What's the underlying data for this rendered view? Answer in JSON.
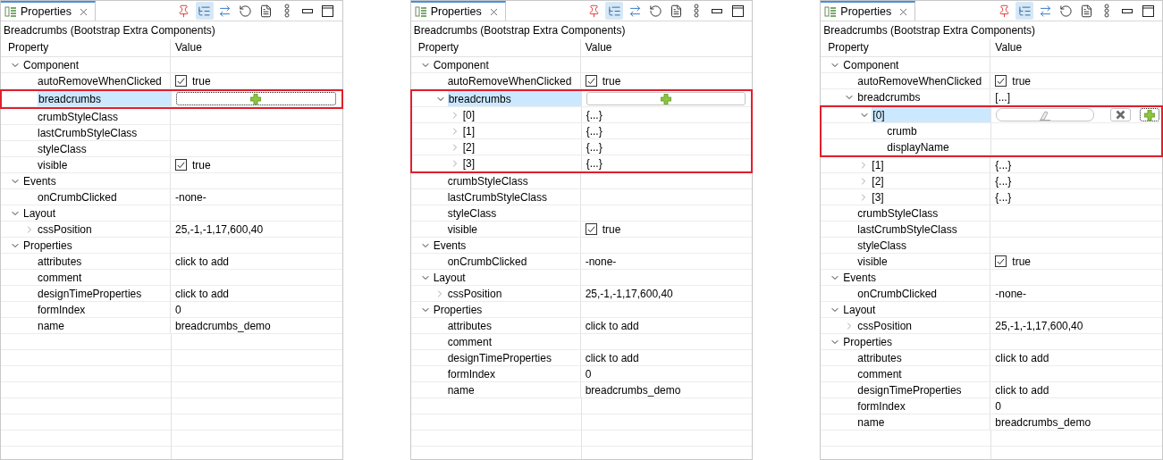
{
  "panels": [
    {
      "tab": {
        "title": "Properties",
        "selected": true
      },
      "subtitle": "Breadcrumbs (Bootstrap Extra Components)",
      "columns": [
        "Property",
        "Value"
      ],
      "rows": [
        {
          "label": "Component",
          "expanded": true,
          "children": [
            {
              "label": "autoRemoveWhenClicked",
              "checked": true,
              "value": "true",
              "selected": false
            },
            {
              "label": "breadcrumbs",
              "selected": true,
              "highlighted": true,
              "editor": {
                "kind": "add",
                "focused": true
              }
            },
            {
              "label": "crumbStyleClass",
              "selected": false
            },
            {
              "label": "lastCrumbStyleClass",
              "selected": false
            },
            {
              "label": "styleClass",
              "selected": false
            },
            {
              "label": "visible",
              "checked": true,
              "value": "true",
              "selected": false
            }
          ]
        },
        {
          "label": "Events",
          "expanded": true,
          "children": [
            {
              "label": "onCrumbClicked",
              "value": "-none-",
              "selected": false
            }
          ]
        },
        {
          "label": "Layout",
          "expanded": true,
          "children": [
            {
              "label": "cssPosition",
              "value": "25,-1,-1,17,600,40",
              "expanded": false,
              "selected": false
            }
          ]
        },
        {
          "label": "Properties",
          "expanded": true,
          "children": [
            {
              "label": "attributes",
              "value": "click to add",
              "selected": false
            },
            {
              "label": "comment",
              "selected": false
            },
            {
              "label": "designTimeProperties",
              "value": "click to add",
              "selected": false
            },
            {
              "label": "formIndex",
              "value": "0",
              "selected": false
            },
            {
              "label": "name",
              "value": "breadcrumbs_demo",
              "selected": false
            }
          ]
        }
      ]
    },
    {
      "tab": {
        "title": "Properties",
        "selected": true
      },
      "subtitle": "Breadcrumbs (Bootstrap Extra Components)",
      "columns": [
        "Property",
        "Value"
      ],
      "rows": [
        {
          "label": "Component",
          "expanded": true,
          "children": [
            {
              "label": "autoRemoveWhenClicked",
              "checked": true,
              "value": "true",
              "selected": false
            },
            {
              "label": "breadcrumbs",
              "selected": true,
              "highlighted": true,
              "expanded": true,
              "editor": {
                "kind": "add",
                "focused": false
              },
              "children": [
                {
                  "label": "[0]",
                  "value": "{...}",
                  "expanded": false,
                  "selected": false,
                  "highlighted": true
                },
                {
                  "label": "[1]",
                  "value": "{...}",
                  "expanded": false,
                  "selected": false,
                  "highlighted": true
                },
                {
                  "label": "[2]",
                  "value": "{...}",
                  "expanded": false,
                  "selected": false,
                  "highlighted": true
                },
                {
                  "label": "[3]",
                  "value": "{...}",
                  "expanded": false,
                  "selected": false,
                  "highlighted": true
                }
              ]
            },
            {
              "label": "crumbStyleClass",
              "selected": false
            },
            {
              "label": "lastCrumbStyleClass",
              "selected": false
            },
            {
              "label": "styleClass",
              "selected": false
            },
            {
              "label": "visible",
              "checked": true,
              "value": "true",
              "selected": false
            }
          ]
        },
        {
          "label": "Events",
          "expanded": true,
          "children": [
            {
              "label": "onCrumbClicked",
              "value": "-none-",
              "selected": false
            }
          ]
        },
        {
          "label": "Layout",
          "expanded": true,
          "children": [
            {
              "label": "cssPosition",
              "value": "25,-1,-1,17,600,40",
              "expanded": false,
              "selected": false
            }
          ]
        },
        {
          "label": "Properties",
          "expanded": true,
          "children": [
            {
              "label": "attributes",
              "value": "click to add",
              "selected": false
            },
            {
              "label": "comment",
              "selected": false
            },
            {
              "label": "designTimeProperties",
              "value": "click to add",
              "selected": false
            },
            {
              "label": "formIndex",
              "value": "0",
              "selected": false
            },
            {
              "label": "name",
              "value": "breadcrumbs_demo",
              "selected": false
            }
          ]
        }
      ]
    },
    {
      "tab": {
        "title": "Properties",
        "selected": true
      },
      "subtitle": "Breadcrumbs (Bootstrap Extra Components)",
      "columns": [
        "Property",
        "Value"
      ],
      "rows": [
        {
          "label": "Component",
          "expanded": true,
          "children": [
            {
              "label": "autoRemoveWhenClicked",
              "checked": true,
              "value": "true",
              "selected": false
            },
            {
              "label": "breadcrumbs",
              "value": "[...]",
              "selected": false,
              "expanded": true,
              "children": [
                {
                  "label": "[0]",
                  "expanded": true,
                  "selected": true,
                  "highlighted": true,
                  "editor": {
                    "kind": "edit",
                    "focused": true
                  },
                  "children": [
                    {
                      "label": "crumb",
                      "selected": false,
                      "highlighted": true
                    },
                    {
                      "label": "displayName",
                      "selected": false,
                      "highlighted": true
                    }
                  ]
                },
                {
                  "label": "[1]",
                  "value": "{...}",
                  "expanded": false,
                  "selected": false
                },
                {
                  "label": "[2]",
                  "value": "{...}",
                  "expanded": false,
                  "selected": false
                },
                {
                  "label": "[3]",
                  "value": "{...}",
                  "expanded": false,
                  "selected": false
                }
              ]
            },
            {
              "label": "crumbStyleClass",
              "selected": false
            },
            {
              "label": "lastCrumbStyleClass",
              "selected": false
            },
            {
              "label": "styleClass",
              "selected": false
            },
            {
              "label": "visible",
              "checked": true,
              "value": "true",
              "selected": false
            }
          ]
        },
        {
          "label": "Events",
          "expanded": true,
          "children": [
            {
              "label": "onCrumbClicked",
              "value": "-none-",
              "selected": false
            }
          ]
        },
        {
          "label": "Layout",
          "expanded": true,
          "children": [
            {
              "label": "cssPosition",
              "value": "25,-1,-1,17,600,40",
              "expanded": false,
              "selected": false
            }
          ]
        },
        {
          "label": "Properties",
          "expanded": true,
          "children": [
            {
              "label": "attributes",
              "value": "click to add",
              "selected": false
            },
            {
              "label": "comment",
              "selected": false
            },
            {
              "label": "designTimeProperties",
              "value": "click to add",
              "selected": false
            },
            {
              "label": "formIndex",
              "value": "0",
              "selected": false
            },
            {
              "label": "name",
              "value": "breadcrumbs_demo",
              "selected": false
            }
          ]
        }
      ]
    }
  ]
}
